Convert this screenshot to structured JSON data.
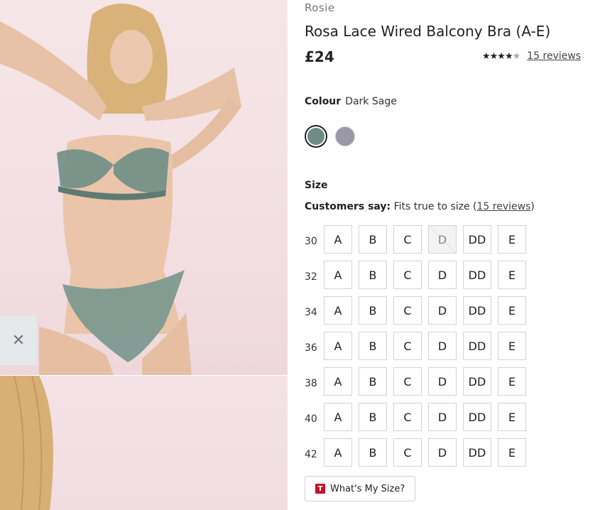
{
  "product": {
    "brand": "Rosie",
    "title": "Rosa Lace Wired Balcony Bra (A-E)",
    "price": "£24",
    "rating": 4.5,
    "reviews_link": "15 reviews"
  },
  "colour": {
    "label": "Colour",
    "selected": "Dark Sage",
    "swatches": [
      {
        "name": "Dark Sage",
        "color": "#6e8c84",
        "selected": true
      },
      {
        "name": "Grey",
        "color": "#9a97a8",
        "selected": false
      }
    ]
  },
  "size": {
    "label": "Size",
    "customers_say_label": "Customers say:",
    "customers_say_text": "Fits true to size (",
    "customers_say_link": "15 reviews",
    "customers_say_close": ")",
    "cups": [
      "A",
      "B",
      "C",
      "D",
      "DD",
      "E"
    ],
    "bands": [
      "30",
      "32",
      "34",
      "36",
      "38",
      "40",
      "42"
    ],
    "out_of_stock": [
      {
        "band": "30",
        "cup": "D"
      }
    ]
  },
  "whats_my_size": {
    "logo": "T",
    "label": "What's My Size?"
  },
  "icons": {
    "close": "close-icon",
    "star": "star-icon"
  }
}
